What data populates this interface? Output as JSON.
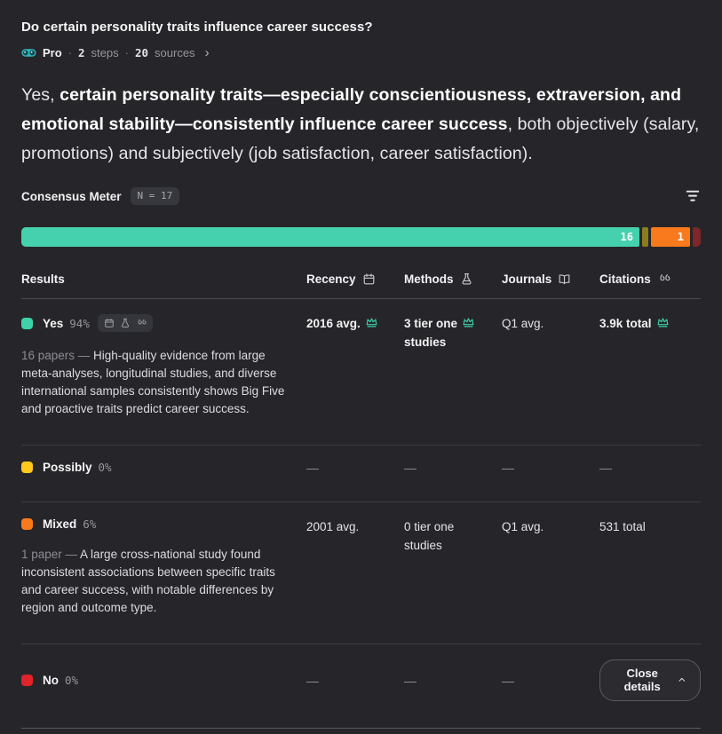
{
  "header": {
    "question": "Do certain personality traits influence career success?",
    "mode_label": "Pro",
    "dot": "·",
    "steps_value": "2",
    "steps_label": "steps",
    "sources_value": "20",
    "sources_label": "sources",
    "chevron": "›"
  },
  "answer": {
    "prefix": "Yes, ",
    "bold": "certain personality traits—especially conscientiousness, extraversion, and emotional stability—consistently influence career success",
    "suffix": ", both objectively (salary, promotions) and subjectively (job satisfaction, career satisfaction)."
  },
  "meter": {
    "title": "Consensus Meter",
    "sample_size": "N = 17",
    "segments": {
      "yes": {
        "name": "Yes",
        "count_label": "16",
        "color": "#45d1ad"
      },
      "possibly": {
        "name": "Possibly",
        "count_label": "",
        "color": "#8d7b20"
      },
      "mixed": {
        "name": "Mixed",
        "count_label": "1",
        "color": "#f87a1c"
      },
      "no": {
        "name": "No",
        "count_label": "",
        "color": "#7e262b"
      }
    }
  },
  "table": {
    "headers": {
      "results": "Results",
      "recency": "Recency",
      "methods": "Methods",
      "journals": "Journals",
      "citations": "Citations"
    },
    "dash": "—",
    "rows": {
      "yes": {
        "label": "Yes",
        "percent": "94%",
        "color": "#3fd1a9",
        "recency": "2016 avg.",
        "methods_line1": "3 tier one",
        "methods_line2": "studies",
        "journals": "Q1 avg.",
        "citations": "3.9k total",
        "papers_prefix": "16 papers — ",
        "description": "High-quality evidence from large meta-analyses, longitudinal studies, and diverse international samples consistently shows Big Five and proactive traits predict career success."
      },
      "possibly": {
        "label": "Possibly",
        "percent": "0%",
        "color": "#fdc91d"
      },
      "mixed": {
        "label": "Mixed",
        "percent": "6%",
        "color": "#f87a1c",
        "recency": "2001 avg.",
        "methods_line1": "0 tier one",
        "methods_line2": "studies",
        "journals": "Q1 avg.",
        "citations": "531 total",
        "papers_prefix": "1 paper — ",
        "description": "A large cross-national study found inconsistent associations between specific traits and career success, with notable differences by region and outcome type."
      },
      "no": {
        "label": "No",
        "percent": "0%",
        "color": "#e0222a"
      }
    },
    "close_button_label": "Close details"
  },
  "colors": {
    "accent_teal": "#3fd1a9",
    "accent_yellow": "#fdc91d",
    "accent_orange": "#f87a1c",
    "accent_red": "#e0222a"
  }
}
